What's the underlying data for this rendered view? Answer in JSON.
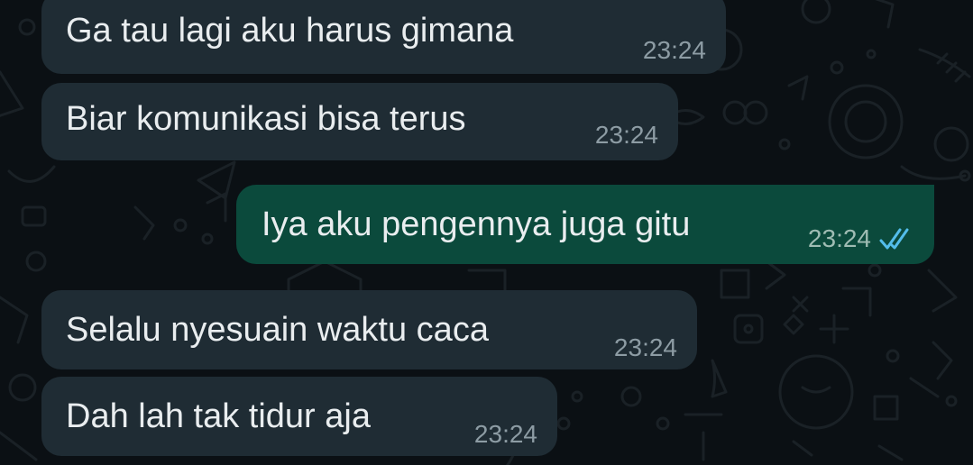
{
  "conversation": {
    "messages": [
      {
        "direction": "incoming",
        "text": "Ga tau lagi aku harus gimana",
        "time": "23:24"
      },
      {
        "direction": "incoming",
        "text": "Biar komunikasi bisa terus",
        "time": "23:24"
      },
      {
        "direction": "outgoing",
        "text": "Iya aku pengennya juga gitu",
        "time": "23:24",
        "status_icon": "double-check-read-icon"
      },
      {
        "direction": "incoming",
        "text": "Selalu nyesuain waktu caca",
        "time": "23:24"
      },
      {
        "direction": "incoming",
        "text": "Dah lah tak tidur aja",
        "time": "23:24"
      }
    ]
  },
  "colors": {
    "background": "#0b1014",
    "incoming_bubble": "#1f2c34",
    "outgoing_bubble": "#0b4a3c",
    "text": "#e9edef",
    "timestamp": "#8d9ca4",
    "read_ticks": "#53bdeb"
  }
}
